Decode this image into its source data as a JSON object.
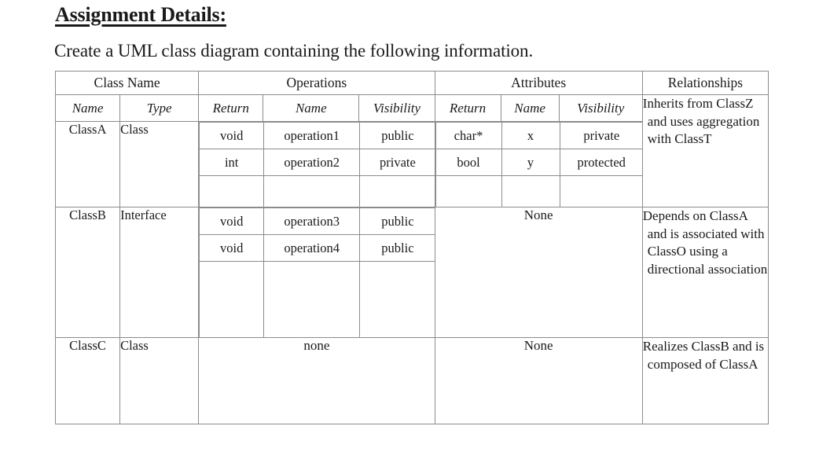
{
  "document": {
    "title": "Assignment Details:",
    "intro": "Create a UML class diagram containing the following information."
  },
  "table": {
    "group_headers": {
      "class_name": "Class Name",
      "operations": "Operations",
      "attributes": "Attributes",
      "relationships": "Relationships"
    },
    "sub_headers": {
      "class_name": "Name",
      "class_type": "Type",
      "op_return": "Return",
      "op_name": "Name",
      "op_visibility": "Visibility",
      "attr_return": "Return",
      "attr_name": "Name",
      "attr_visibility": "Visibility"
    },
    "rows": [
      {
        "class_name": "ClassA",
        "class_type": "Class",
        "operations": [
          {
            "return": "void",
            "name": "operation1",
            "visibility": "public"
          },
          {
            "return": "int",
            "name": "operation2",
            "visibility": "private"
          }
        ],
        "attributes": [
          {
            "return": "char*",
            "name": "x",
            "visibility": "private"
          },
          {
            "return": "bool",
            "name": "y",
            "visibility": "protected"
          }
        ],
        "relationships": "Inherits from ClassZ and uses aggregation with ClassT"
      },
      {
        "class_name": "ClassB",
        "class_type": "Interface",
        "operations": [
          {
            "return": "void",
            "name": "operation3",
            "visibility": "public"
          },
          {
            "return": "void",
            "name": "operation4",
            "visibility": "public"
          }
        ],
        "attributes_none": "None",
        "relationships": "Depends on ClassA and is associated with ClassO using a directional association"
      },
      {
        "class_name": "ClassC",
        "class_type": "Class",
        "operations_none": "none",
        "attributes_none": "None",
        "relationships": "Realizes ClassB and is composed of ClassA"
      }
    ]
  }
}
